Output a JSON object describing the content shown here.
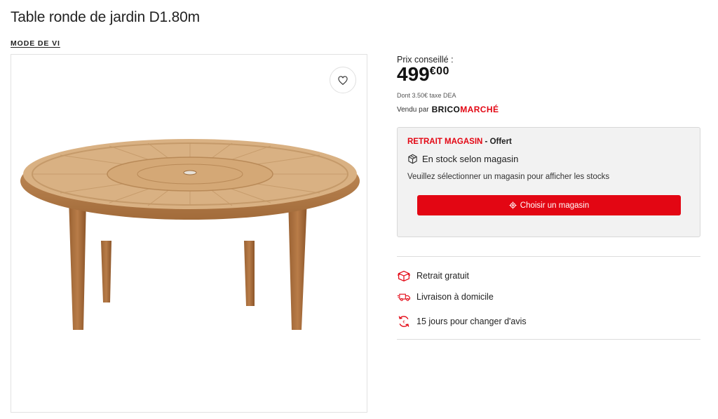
{
  "product": {
    "title": "Table ronde de jardin D1.80m",
    "brand": "MODE DE VI"
  },
  "price": {
    "label": "Prix conseillé :",
    "integer": "499",
    "cents": "€00",
    "tax_note": "Dont 3.50€ taxe DEA",
    "sold_by_label": "Vendu par",
    "seller_part1": "BRICO",
    "seller_part2": "MARCHÉ"
  },
  "store_pickup": {
    "title": "RETRAIT MAGASIN",
    "title_suffix": " - Offert",
    "stock_text": "En stock selon magasin",
    "message": "Veuillez sélectionner un magasin pour afficher les stocks",
    "button_label": "Choisir un magasin"
  },
  "features": [
    {
      "label": "Retrait gratuit",
      "icon": "box-icon"
    },
    {
      "label": "Livraison à domicile",
      "icon": "truck-icon"
    },
    {
      "label": "15 jours pour changer d'avis",
      "icon": "return-icon"
    }
  ],
  "colors": {
    "accent": "#e30613",
    "panel_bg": "#f2f2f2"
  }
}
